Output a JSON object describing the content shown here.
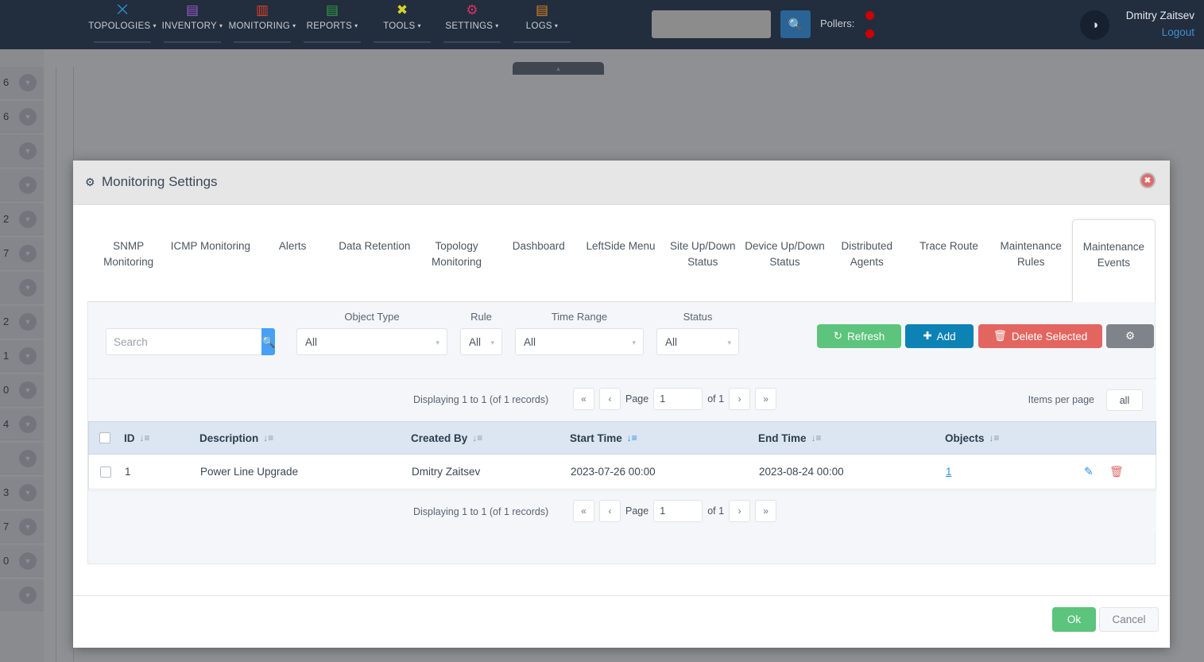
{
  "topbar": {
    "nav_items": [
      {
        "label": "TOPOLOGIES",
        "icon": "topology-icon",
        "glyph": "⨉",
        "color": "#2b8fd0"
      },
      {
        "label": "INVENTORY",
        "icon": "inventory-icon",
        "glyph": "▤",
        "color": "#9b59d0"
      },
      {
        "label": "MONITORING",
        "icon": "monitoring-icon",
        "glyph": "▥",
        "color": "#e0402b"
      },
      {
        "label": "REPORTS",
        "icon": "reports-icon",
        "glyph": "▤",
        "color": "#2f9e41"
      },
      {
        "label": "TOOLS",
        "icon": "tools-icon",
        "glyph": "✖",
        "color": "#d6d22b"
      },
      {
        "label": "SETTINGS",
        "icon": "settings-icon",
        "glyph": "⚙",
        "color": "#d6306e"
      },
      {
        "label": "LOGS",
        "icon": "logs-icon",
        "glyph": "▤",
        "color": "#d98020"
      }
    ],
    "caret": "▾",
    "search_value": "",
    "search_icon": "🔍",
    "pollers_label": "Pollers:",
    "poller_status_color": "#cc0000",
    "theme_icon": "◑",
    "user_name": "Dmitry Zaitsev",
    "logout_label": "Logout"
  },
  "background": {
    "sidebar_items": [
      {
        "num": "6"
      },
      {
        "num": "6"
      },
      {
        "num": ""
      },
      {
        "num": ""
      },
      {
        "num": "2"
      },
      {
        "num": "7"
      },
      {
        "num": ""
      },
      {
        "num": "2"
      },
      {
        "num": "1"
      },
      {
        "num": "0"
      },
      {
        "num": "4"
      },
      {
        "num": ""
      },
      {
        "num": "3"
      },
      {
        "num": "7"
      },
      {
        "num": "0"
      },
      {
        "num": ""
      }
    ],
    "chevron_glyph": "▼",
    "collapse_tab_glyph": "▲"
  },
  "modal": {
    "title": "Monitoring Settings",
    "title_icon": "gears-icon",
    "close_icon": "✖",
    "tabs": [
      {
        "label": "SNMP Monitoring",
        "active": false
      },
      {
        "label": "ICMP Monitoring",
        "active": false
      },
      {
        "label": "Alerts",
        "active": false
      },
      {
        "label": "Data Retention",
        "active": false
      },
      {
        "label": "Topology Monitoring",
        "active": false
      },
      {
        "label": "Dashboard",
        "active": false
      },
      {
        "label": "LeftSide Menu",
        "active": false
      },
      {
        "label": "Site Up/Down Status",
        "active": false
      },
      {
        "label": "Device Up/Down Status",
        "active": false
      },
      {
        "label": "Distributed Agents",
        "active": false
      },
      {
        "label": "Trace Route",
        "active": false
      },
      {
        "label": "Maintenance Rules",
        "active": false
      },
      {
        "label": "Maintenance Events",
        "active": true
      }
    ],
    "footer": {
      "ok_label": "Ok",
      "cancel_label": "Cancel"
    }
  },
  "filters": {
    "search_placeholder": "Search",
    "search_value": "",
    "search_icon": "🔍",
    "object_type": {
      "label": "Object Type",
      "value": "All"
    },
    "rule": {
      "label": "Rule",
      "value": "All"
    },
    "time_range": {
      "label": "Time Range",
      "value": "All"
    },
    "status": {
      "label": "Status",
      "value": "All"
    },
    "caret": "▾",
    "buttons": {
      "refresh": {
        "label": "Refresh",
        "icon": "↻",
        "color": "#5cc47c"
      },
      "add": {
        "label": "Add",
        "icon": "✚",
        "color": "#0d82b5"
      },
      "delete": {
        "label": "Delete Selected",
        "icon": "🗑",
        "color": "#e36560"
      },
      "gear": {
        "label": "",
        "icon": "⚙",
        "color": "#7f838a"
      }
    }
  },
  "pagination": {
    "count_text": "Displaying 1 to 1 (of 1 records)",
    "first_icon": "«",
    "prev_icon": "‹",
    "page_label": "Page",
    "page_value": "1",
    "of_text": "of 1",
    "next_icon": "›",
    "last_icon": "»",
    "items_per_page_label": "Items per page",
    "items_per_page_value": "all"
  },
  "table": {
    "sort_icon": "↓≡",
    "columns": [
      {
        "key": "id",
        "label": "ID",
        "sorted": false
      },
      {
        "key": "description",
        "label": "Description",
        "sorted": false
      },
      {
        "key": "created_by",
        "label": "Created By",
        "sorted": false
      },
      {
        "key": "start_time",
        "label": "Start Time",
        "sorted": true
      },
      {
        "key": "end_time",
        "label": "End Time",
        "sorted": false
      },
      {
        "key": "objects",
        "label": "Objects",
        "sorted": false
      }
    ],
    "rows": [
      {
        "id": "1",
        "description": "Power Line Upgrade",
        "created_by": "Dmitry Zaitsev",
        "start_time": "2023-07-26 00:00",
        "end_time": "2023-08-24 00:00",
        "objects": "1",
        "edit_icon": "✎",
        "delete_icon": "🗑"
      }
    ]
  }
}
